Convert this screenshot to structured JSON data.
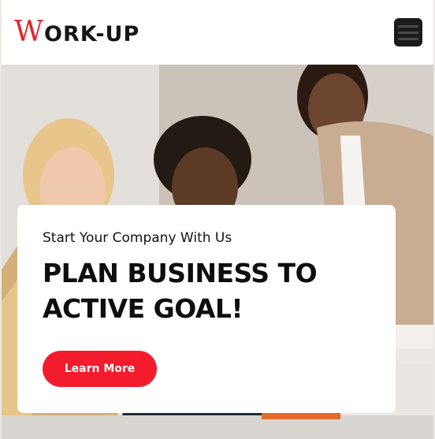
{
  "header": {
    "logo_mark": "W",
    "logo_text": "ORK-UP",
    "menu_icon": "hamburger-menu-icon"
  },
  "hero": {
    "eyebrow": "Start Your Company With Us",
    "title": "PLAN BUSINESS TO ACTIVE GOAL!",
    "cta_label": "Learn More"
  },
  "colors": {
    "accent": "#f31c2d",
    "logo_mark": "#e0262d",
    "text": "#0e0e0e",
    "menu_button": "#1c1c1c"
  }
}
